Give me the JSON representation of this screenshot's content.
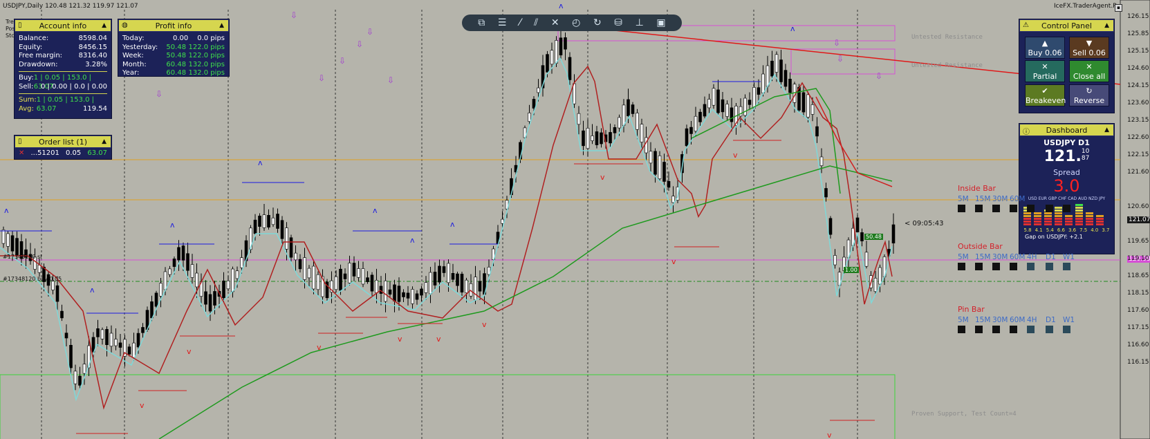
{
  "chart": {
    "header": "USDJPY,Daily  120.48 121.32 119.97 121.07",
    "broker": "IceFX.TraderAgent.Pro",
    "overlay_lines": [
      "Tre",
      "Pos",
      "Stc",
      "27"
    ],
    "price_labels": [
      "126.15",
      "125.85",
      "125.15",
      "124.60",
      "124.15",
      "123.60",
      "123.15",
      "122.60",
      "122.15",
      "121.60",
      "121.07",
      "120.60",
      "120.08",
      "119.65",
      "119.10",
      "118.65",
      "118.15",
      "117.60",
      "117.15",
      "116.60",
      "116.15"
    ],
    "highlight_prices": {
      "current": "121.07",
      "pink": "120.08"
    },
    "countdown": "< 09:05:43",
    "zone_labels": {
      "resistance1": "Untested Resistance",
      "resistance2": "Untested Resistance",
      "support": "Proven Support, Test Count=4"
    },
    "order_marks": [
      "#17348120 sl",
      "#17348120 buy 0.05"
    ],
    "trade_box": {
      "profit": "50.48",
      "lots": "1.00"
    }
  },
  "account_info": {
    "title": "Account info",
    "rows": [
      {
        "label": "Balance:",
        "value": "8598.04"
      },
      {
        "label": "Equity:",
        "value": "8456.15"
      },
      {
        "label": "Free margin:",
        "value": "8316.40"
      },
      {
        "label": "Drawdown:",
        "value": "3.28%"
      }
    ],
    "buy": {
      "label": "Buy:",
      "value": "1 | 0.05 | 153.0 | 63.07"
    },
    "sell": {
      "label": "Sell:",
      "value": "0 | 0.00 | 0.0 | 0.00"
    },
    "sum": {
      "label": "Sum:",
      "value": "1 | 0.05 | 153.0 | 63.07"
    },
    "avg": {
      "label": "Avg:",
      "value": "119.54"
    }
  },
  "profit_info": {
    "title": "Profit info",
    "rows": [
      {
        "label": "Today:",
        "value": "0.00",
        "pips": "0.0 pips"
      },
      {
        "label": "Yesterday:",
        "value": "50.48",
        "pips": "122.0 pips"
      },
      {
        "label": "Week:",
        "value": "50.48",
        "pips": "122.0 pips"
      },
      {
        "label": "Month:",
        "value": "60.48",
        "pips": "132.0 pips"
      },
      {
        "label": "Year:",
        "value": "60.48",
        "pips": "132.0 pips"
      }
    ]
  },
  "order_list": {
    "title": "Order list (1)",
    "order": {
      "id": "...51201",
      "lots": "0.05",
      "profit": "63.07"
    }
  },
  "control_panel": {
    "title": "Control Panel",
    "buy": "Buy 0.06",
    "sell": "Sell 0.06",
    "partial": "Partial",
    "close_all": "Close all",
    "breakeven": "Breakeven",
    "reverse": "Reverse"
  },
  "dashboard": {
    "title": "Dashboard",
    "symbol": "USDJPY D1",
    "price_main": "121.",
    "price_sup": "10",
    "price_sub": "87",
    "spread_label": "Spread",
    "spread_value": "3.0",
    "currencies": "USD EUR GBP CHF CAD AUD NZD JPY",
    "bar_values": [
      "5.8",
      "4.1",
      "5.4",
      "6.6",
      "3.6",
      "7.5",
      "4.0",
      "3.7"
    ],
    "bar_levels": [
      5.8,
      4.1,
      5.4,
      6.6,
      3.6,
      7.5,
      4.0,
      3.7
    ],
    "gap": "Gap on USDJPY:  +2.1"
  },
  "patterns": [
    {
      "name": "Inside Bar",
      "tfs": [
        "5M",
        "15M",
        "30M",
        "60M"
      ]
    },
    {
      "name": "Outside Bar",
      "tfs": [
        "5M",
        "15M",
        "30M",
        "60M",
        "4H",
        "D1",
        "W1"
      ]
    },
    {
      "name": "Pin Bar",
      "tfs": [
        "5M",
        "15M",
        "30M",
        "60M",
        "4H",
        "D1",
        "W1"
      ]
    }
  ],
  "colors": {
    "background": "#b5b4ab",
    "panel": "#1c2258",
    "header_yellow": "#d6d64f",
    "fast_ma": "#7fd8d8",
    "slow_ma": "#1e9a1e",
    "resistance_red": "#e01818",
    "zone_magenta": "#d64fd6"
  },
  "icons": [
    "new-window-icon",
    "menu-icon",
    "trendline-icon",
    "channel-icon",
    "crosshair-icon",
    "clock-icon",
    "refresh-icon",
    "database-icon",
    "level-icon",
    "camera-icon"
  ]
}
